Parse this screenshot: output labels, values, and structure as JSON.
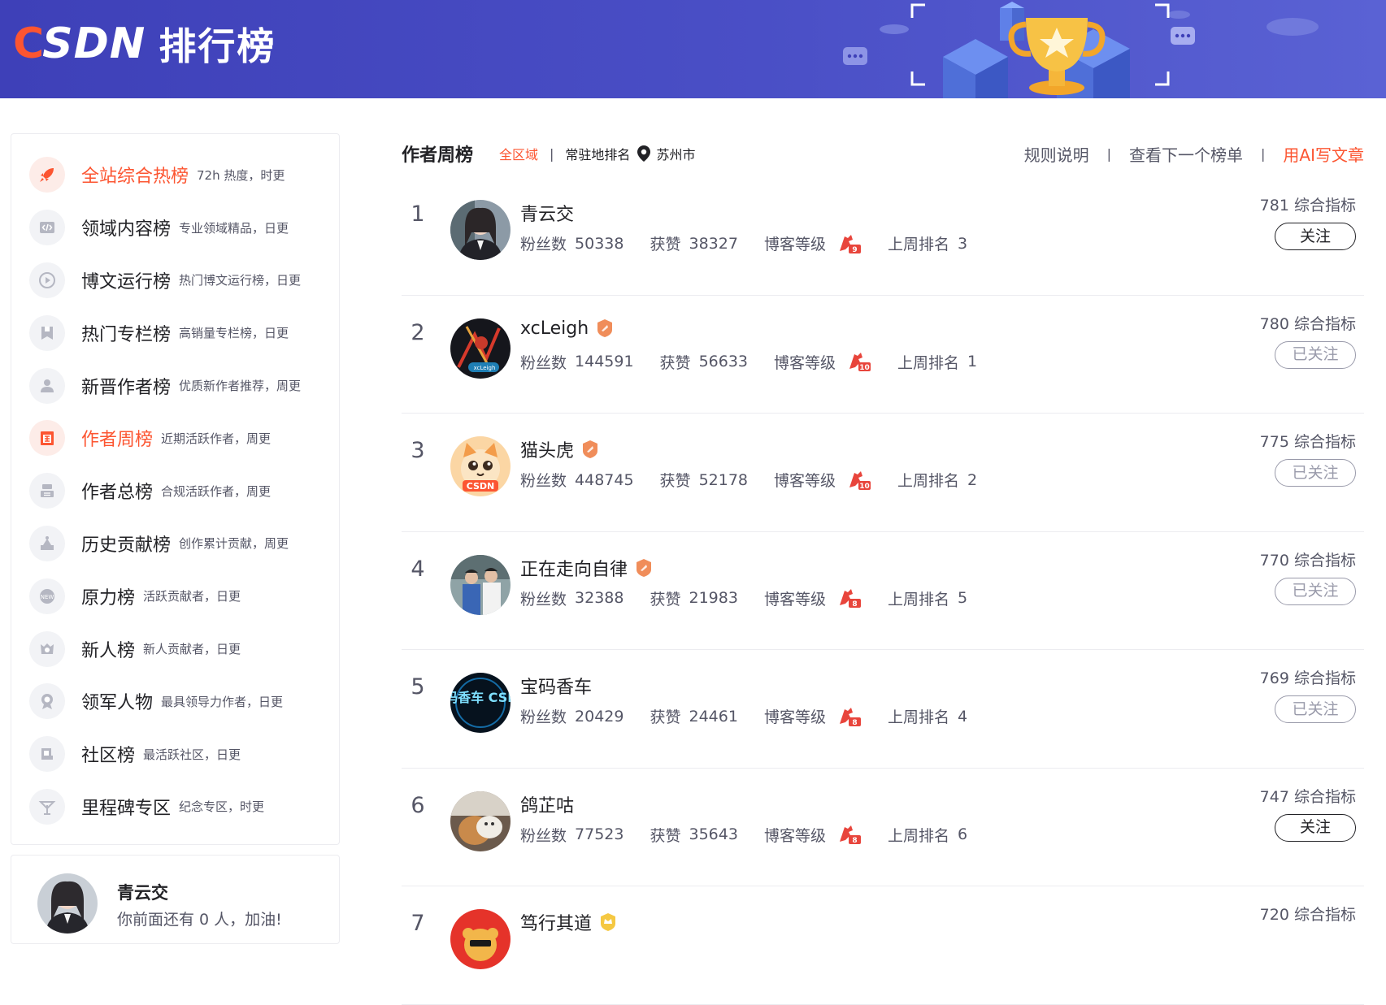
{
  "header": {
    "logo_c": "C",
    "logo_rest": "SDN",
    "title": "排行榜"
  },
  "sidebar": {
    "items": [
      {
        "label": "全站综合热榜",
        "desc": "72h 热度，时更",
        "icon": "rocket-icon",
        "active": true
      },
      {
        "label": "领域内容榜",
        "desc": "专业领域精品，日更",
        "icon": "code-icon",
        "active": false
      },
      {
        "label": "博文运行榜",
        "desc": "热门博文运行榜，日更",
        "icon": "play-icon",
        "active": false
      },
      {
        "label": "热门专栏榜",
        "desc": "高销量专栏榜，日更",
        "icon": "bookmark-icon",
        "active": false
      },
      {
        "label": "新晋作者榜",
        "desc": "优质新作者推荐，周更",
        "icon": "user-icon",
        "active": false
      },
      {
        "label": "作者周榜",
        "desc": "近期活跃作者，周更",
        "icon": "calendar-icon",
        "active": true
      },
      {
        "label": "作者总榜",
        "desc": "合规活跃作者，周更",
        "icon": "group-icon",
        "active": false
      },
      {
        "label": "历史贡献榜",
        "desc": "创作累计贡献，周更",
        "icon": "history-icon",
        "active": false
      },
      {
        "label": "原力榜",
        "desc": "活跃贡献者，日更",
        "icon": "power-icon",
        "active": false
      },
      {
        "label": "新人榜",
        "desc": "新人贡献者，日更",
        "icon": "newbie-icon",
        "active": false
      },
      {
        "label": "领军人物",
        "desc": "最具领导力作者，日更",
        "icon": "medal-icon",
        "active": false
      },
      {
        "label": "社区榜",
        "desc": "最活跃社区，日更",
        "icon": "community-icon",
        "active": false
      },
      {
        "label": "里程碑专区",
        "desc": "纪念专区，时更",
        "icon": "milestone-icon",
        "active": false
      }
    ]
  },
  "user_card": {
    "name": "青云交",
    "hint": "你前面还有 0 人，加油!"
  },
  "toolbar": {
    "title": "作者周榜",
    "region": "全区域",
    "sep": "|",
    "local_rank": "常驻地排名",
    "city": "苏州市",
    "rules": "规则说明",
    "next_list": "查看下一个榜单",
    "ai_write": "用AI写文章"
  },
  "labels": {
    "fans": "粉丝数",
    "likes": "获赞",
    "level": "博客等级",
    "last_week": "上周排名",
    "score_suffix": "综合指标"
  },
  "ranks": [
    {
      "rank": "1",
      "name": "青云交",
      "fans": "50338",
      "likes": "38327",
      "level": "9",
      "last_week": "3",
      "score": "781",
      "button": "关注",
      "followed": false,
      "badge": "none"
    },
    {
      "rank": "2",
      "name": "xcLeigh",
      "fans": "144591",
      "likes": "56633",
      "level": "10",
      "last_week": "1",
      "score": "780",
      "button": "已关注",
      "followed": true,
      "badge": "orange"
    },
    {
      "rank": "3",
      "name": "猫头虎",
      "fans": "448745",
      "likes": "52178",
      "level": "10",
      "last_week": "2",
      "score": "775",
      "button": "已关注",
      "followed": true,
      "badge": "orange"
    },
    {
      "rank": "4",
      "name": "正在走向自律",
      "fans": "32388",
      "likes": "21983",
      "level": "8",
      "last_week": "5",
      "score": "770",
      "button": "已关注",
      "followed": true,
      "badge": "orange"
    },
    {
      "rank": "5",
      "name": "宝码香车",
      "fans": "20429",
      "likes": "24461",
      "level": "8",
      "last_week": "4",
      "score": "769",
      "button": "已关注",
      "followed": true,
      "badge": "none"
    },
    {
      "rank": "6",
      "name": "鸽芷咕",
      "fans": "77523",
      "likes": "35643",
      "level": "8",
      "last_week": "6",
      "score": "747",
      "button": "关注",
      "followed": false,
      "badge": "none"
    },
    {
      "rank": "7",
      "name": "笃行其道",
      "fans": "",
      "likes": "",
      "level": "",
      "last_week": "",
      "score": "720",
      "button": "",
      "followed": false,
      "badge": "gold"
    }
  ],
  "avatar_text": {
    "xcleigh": "xcLeigh",
    "maotouhu": "CSDN",
    "baoma": "宝码香车 CSDN"
  },
  "colors": {
    "brand": "#fc5531",
    "banner": "#4a4fc6",
    "text": "#222226",
    "muted": "#555666",
    "disabled": "#999aaa"
  }
}
